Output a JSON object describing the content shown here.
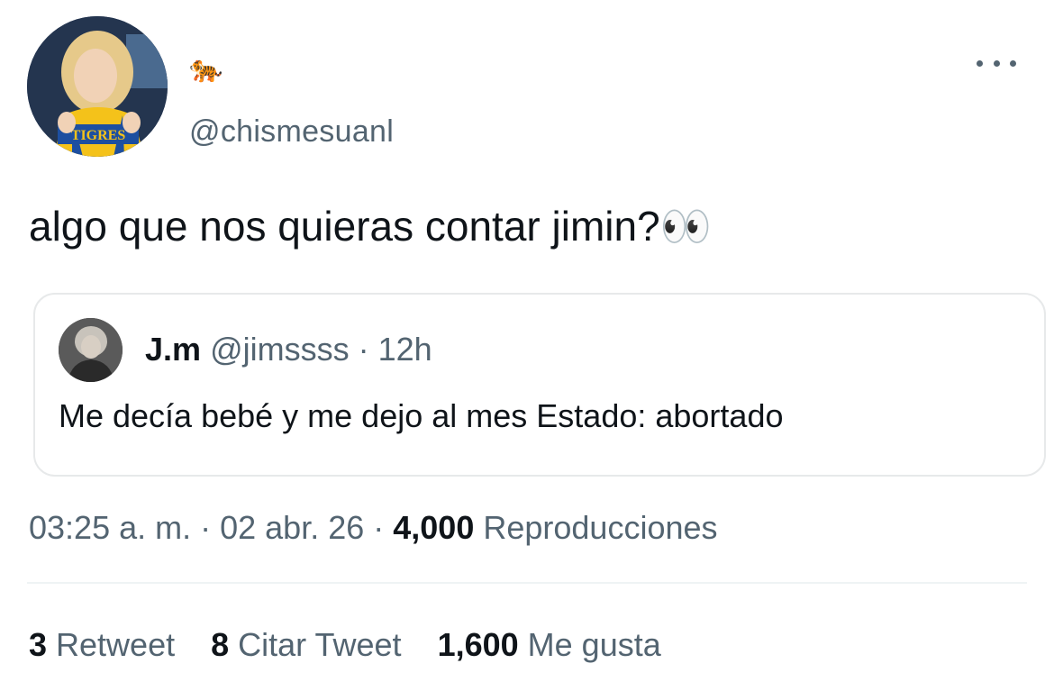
{
  "author": {
    "display_name": "🐅",
    "handle": "@chismesuanl",
    "avatar_text": "TIGRES"
  },
  "tweet": {
    "text": "algo que nos quieras contar jimin?👀"
  },
  "quote": {
    "name": "J.m",
    "handle": "@jimssss",
    "separator": " · ",
    "time": "12h",
    "text": "Me decía bebé y me dejo al mes Estado: abortado"
  },
  "meta": {
    "time": "03:25 a. m.",
    "separator": " · ",
    "date": "02 abr. 26",
    "views_count": "4,000",
    "views_label": " Reproducciones"
  },
  "stats": {
    "retweets_count": "3",
    "retweets_label": " Retweet",
    "quotes_count": "8",
    "quotes_label": " Citar Tweet",
    "likes_count": "1,600",
    "likes_label": " Me gusta"
  },
  "icons": {
    "more": "more-horizontal-icon"
  },
  "colors": {
    "text_primary": "#0f1419",
    "text_secondary": "#536471",
    "border": "#e7e9ea",
    "jersey_yellow": "#f4c21a",
    "jersey_blue": "#1d4fa0"
  }
}
